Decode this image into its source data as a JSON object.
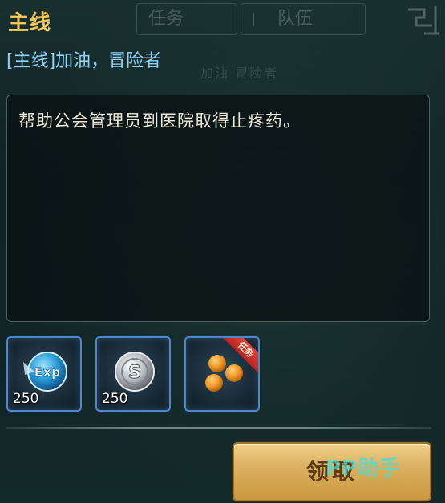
{
  "background_tabs": {
    "tab_one_label": "任务",
    "tab_two_label": "队伍"
  },
  "header": {
    "section_title": "主线"
  },
  "quest": {
    "name": "[主线]加油，冒险者",
    "background_ghost_text": "加油  冒险者",
    "description": "帮助公会管理员到医院取得止疼药。"
  },
  "rewards": [
    {
      "icon": "exp-orb-icon",
      "icon_text": "Exp",
      "quantity": "250"
    },
    {
      "icon": "silver-coin-icon",
      "icon_text": "S",
      "quantity": "250"
    },
    {
      "icon": "orange-pills-icon",
      "ribbon": "任务"
    }
  ],
  "actions": {
    "claim_label": "领取"
  },
  "watermark": "PP助手",
  "colors": {
    "title_gold": "#f2c75a",
    "quest_name_blue": "#8fd0f4",
    "reward_border_blue": "#4f86c9",
    "button_gold": "#dcb161",
    "ribbon_red": "#d2332c"
  }
}
